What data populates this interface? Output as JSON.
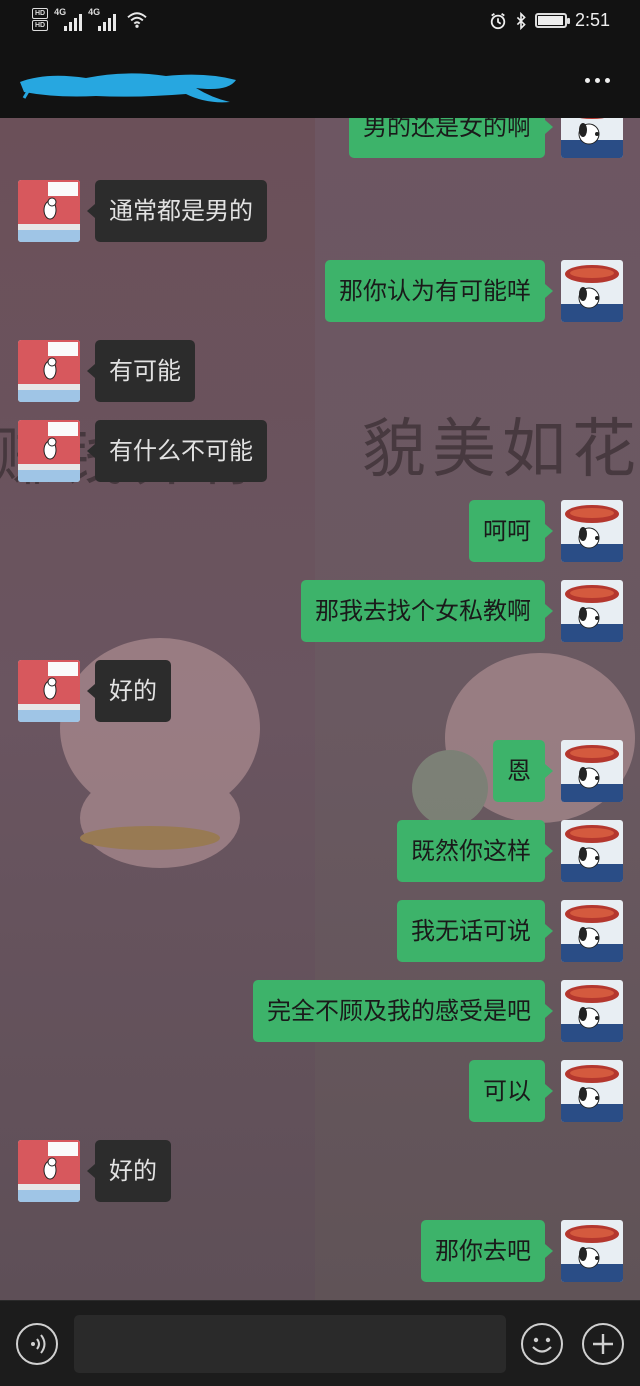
{
  "status_bar": {
    "hd_top": "HD",
    "hd_bottom": "HD",
    "network_1": "4G",
    "network_2": "4G",
    "time": "2:51",
    "icons": [
      "alarm-icon",
      "bluetooth-icon",
      "battery-icon",
      "wifi-icon",
      "signal-icon"
    ]
  },
  "header": {
    "contact_name_redacted": true,
    "more_icon": "more-dots-icon"
  },
  "background": {
    "text_left": "赚钱养你",
    "text_right": "貌美如花"
  },
  "messages": [
    {
      "side": "out",
      "text": "男的还是女的啊"
    },
    {
      "side": "in",
      "text": "通常都是男的"
    },
    {
      "side": "out",
      "text": "那你认为有可能咩"
    },
    {
      "side": "in",
      "text": "有可能"
    },
    {
      "side": "in",
      "text": "有什么不可能"
    },
    {
      "side": "out",
      "text": "呵呵"
    },
    {
      "side": "out",
      "text": "那我去找个女私教啊"
    },
    {
      "side": "in",
      "text": "好的"
    },
    {
      "side": "out",
      "text": "恩"
    },
    {
      "side": "out",
      "text": "既然你这样"
    },
    {
      "side": "out",
      "text": "我无话可说"
    },
    {
      "side": "out",
      "text": "完全不顾及我的感受是吧"
    },
    {
      "side": "out",
      "text": "可以"
    },
    {
      "side": "in",
      "text": "好的"
    },
    {
      "side": "out",
      "text": "那你去吧"
    }
  ],
  "input_bar": {
    "placeholder": "",
    "icons": [
      "voice-icon",
      "emoji-icon",
      "plus-icon"
    ]
  },
  "colors": {
    "outgoing_bubble": "#3db36a",
    "incoming_bubble": "#2c2c2c",
    "bar_background": "#121212"
  }
}
